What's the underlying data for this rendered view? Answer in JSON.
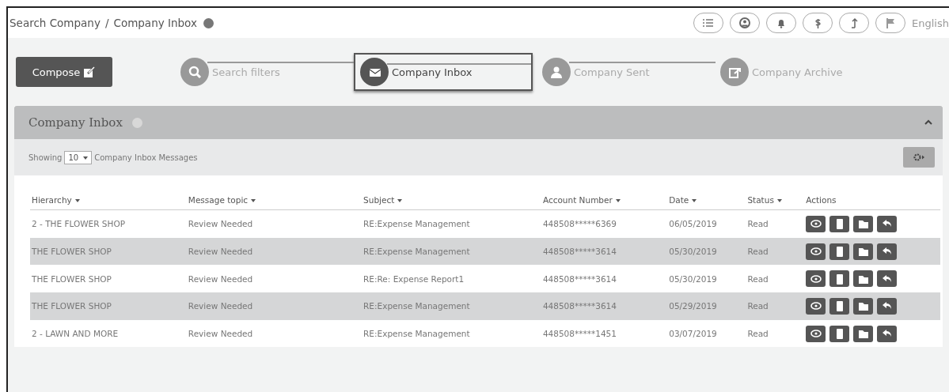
{
  "breadcrumb": [
    "Search Company",
    "/",
    "Company Inbox"
  ],
  "language": "English",
  "compose": "Compose",
  "steps": [
    {
      "label": "Search filters",
      "kind": "search",
      "selected": false
    },
    {
      "label": "Company Inbox",
      "kind": "inbox",
      "selected": true
    },
    {
      "label": "Company Sent",
      "kind": "sent",
      "selected": false
    },
    {
      "label": "Company Archive",
      "kind": "archive",
      "selected": false
    }
  ],
  "panel": {
    "title": "Company Inbox",
    "showing": "Showing",
    "page_size": "10",
    "showing_suffix": "Company Inbox Messages"
  },
  "table": {
    "columns": [
      {
        "label": "Hierarchy",
        "sortable": true
      },
      {
        "label": "Message topic",
        "sortable": true
      },
      {
        "label": "Subject",
        "sortable": true
      },
      {
        "label": "Account Number",
        "sortable": true
      },
      {
        "label": "Date",
        "sortable": true
      },
      {
        "label": "Status",
        "sortable": true
      },
      {
        "label": "Actions",
        "sortable": false
      }
    ],
    "rows": [
      {
        "cells": [
          "2 - THE FLOWER SHOP",
          "Review Needed",
          "RE:Expense Management",
          "448508*****6369",
          "06/05/2019",
          "Read"
        ]
      },
      {
        "cells": [
          "THE FLOWER SHOP",
          "Review Needed",
          "RE:Expense Management",
          "448508*****3614",
          "05/30/2019",
          "Read"
        ]
      },
      {
        "cells": [
          "THE FLOWER SHOP",
          "Review Needed",
          "RE:Re: Expense Report1",
          "448508*****3614",
          "05/30/2019",
          "Read"
        ]
      },
      {
        "cells": [
          "THE FLOWER SHOP",
          "Review Needed",
          "RE:Expense Management",
          "448508*****3614",
          "05/29/2019",
          "Read"
        ]
      },
      {
        "cells": [
          "2 - LAWN AND MORE",
          "Review Needed",
          "RE:Expense Management",
          "448508*****1451",
          "03/07/2019",
          "Read"
        ]
      }
    ]
  }
}
